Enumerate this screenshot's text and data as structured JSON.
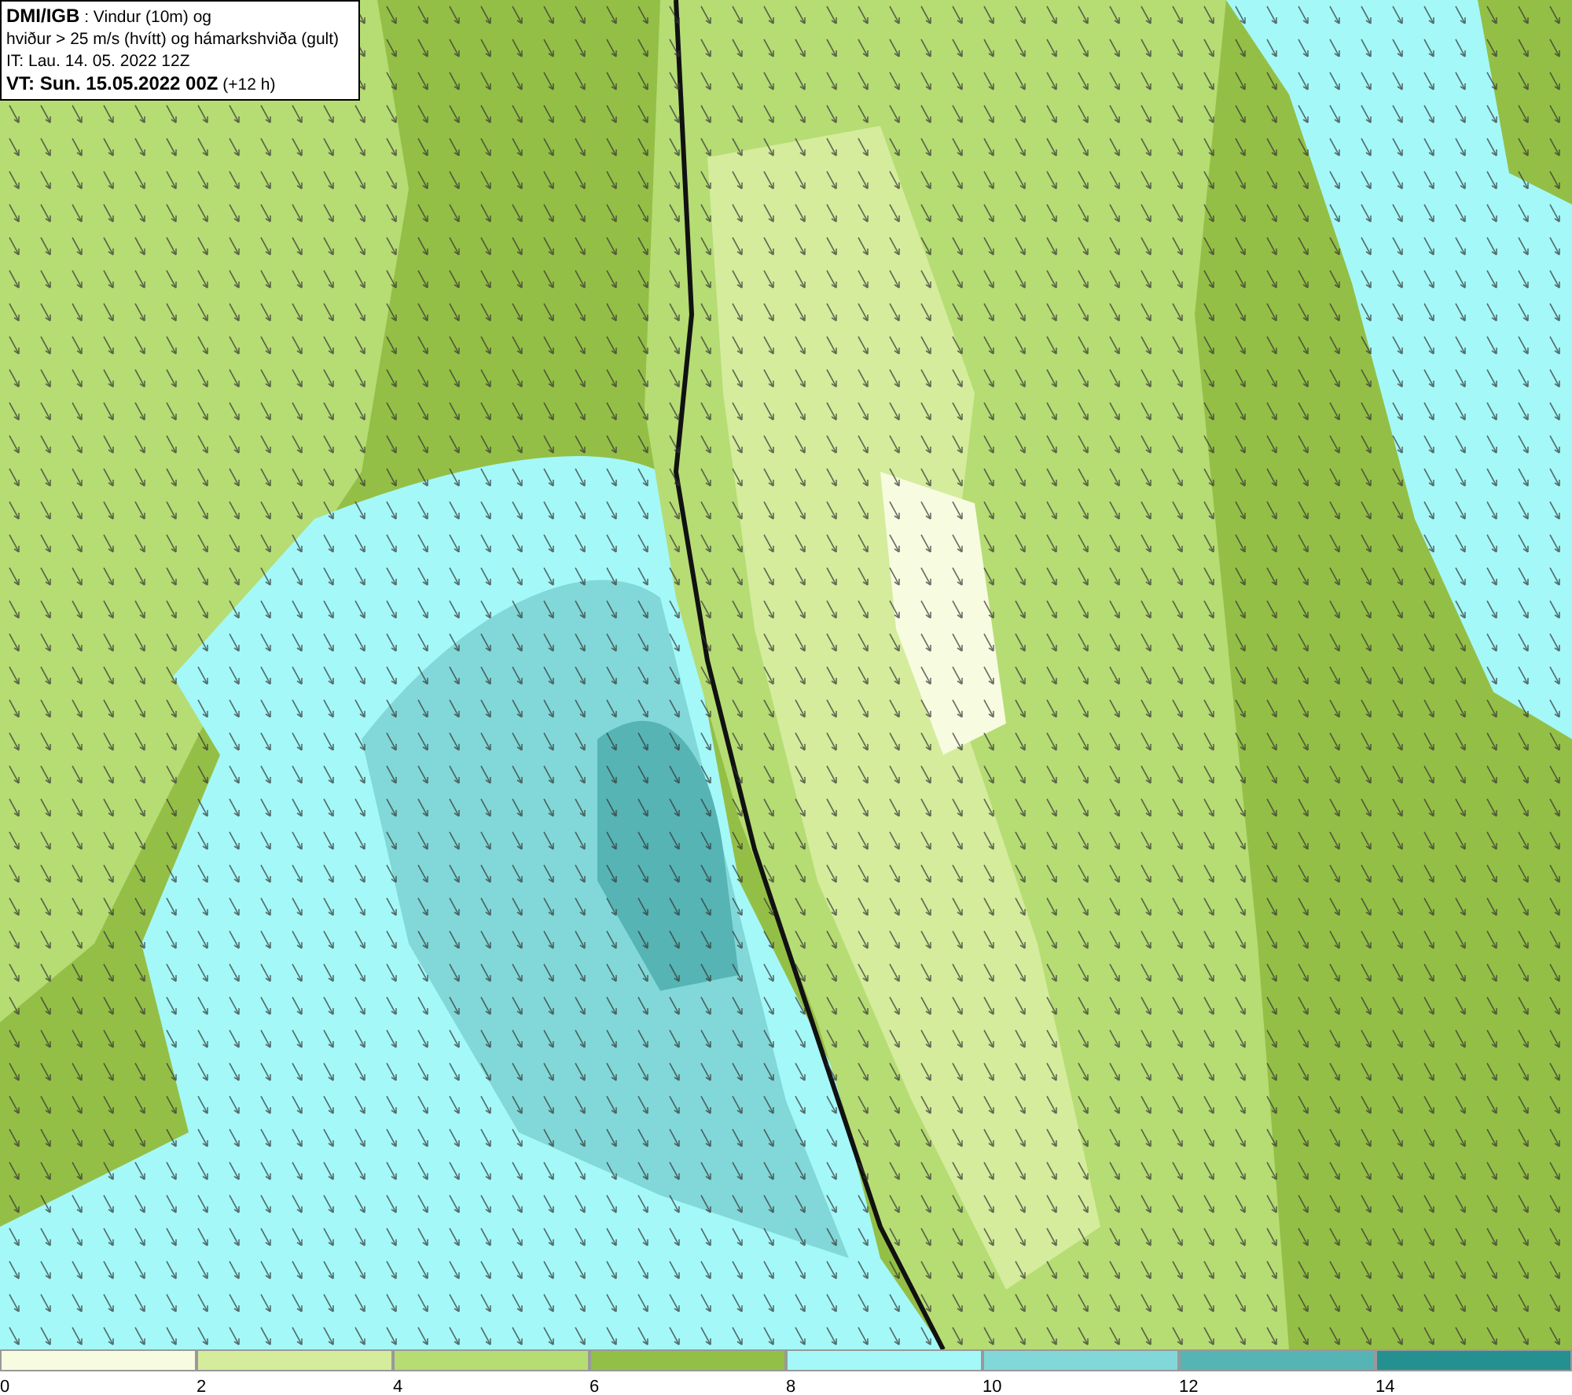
{
  "info_box": {
    "lines": [
      "**DMI/IGB** : Vindur (10m) og",
      "hviður > 25 m/s (hvítt) og hámarkshviða (gult)",
      "IT: Lau. 14. 05. 2022 12Z",
      "**VT: Sun. 15.05.2022 00Z** (+12 h)"
    ]
  },
  "legend": {
    "bins": [
      {
        "color": "#f7fbe0"
      },
      {
        "color": "#d4ec9c"
      },
      {
        "color": "#b6dc74"
      },
      {
        "color": "#94bf46"
      },
      {
        "color": "#a4f8f8"
      },
      {
        "color": "#82d8d8"
      },
      {
        "color": "#56b4b4"
      },
      {
        "color": "#249090"
      }
    ],
    "ticks": [
      "0",
      "2",
      "4",
      "6",
      "8",
      "10",
      "12",
      "14"
    ]
  }
}
